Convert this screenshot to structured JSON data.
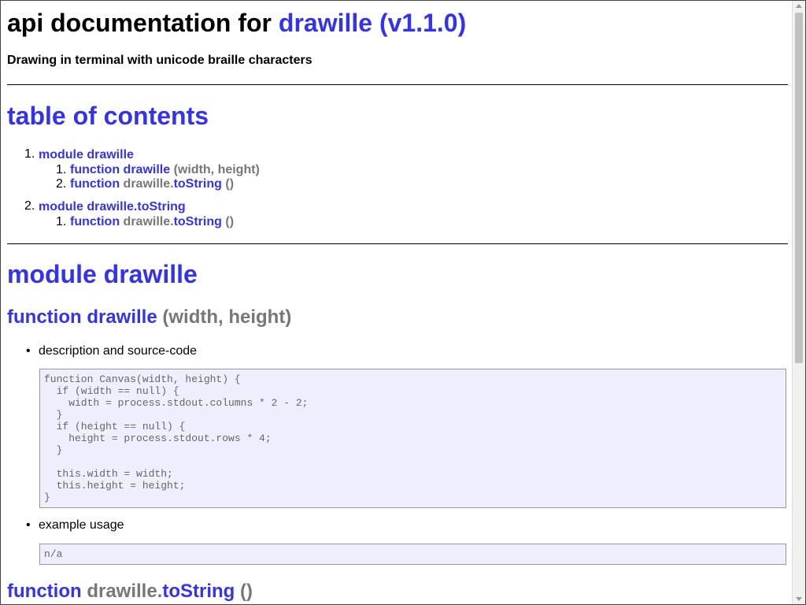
{
  "header": {
    "title_prefix": "api documentation for",
    "title_link": "drawille (v1.1.0)",
    "subtitle": "Drawing in terminal with unicode braille characters"
  },
  "toc": {
    "heading": "table of contents",
    "items": [
      {
        "num": "1.",
        "label": "module drawille",
        "subs": [
          {
            "num": "1.",
            "kw": "function",
            "name": "drawille",
            "args": "(width, height)"
          },
          {
            "num": "2.",
            "kw": "function",
            "owner": "drawille.",
            "name": "toString",
            "args": "()"
          }
        ]
      },
      {
        "num": "2.",
        "label": "module drawille.toString",
        "subs": [
          {
            "num": "1.",
            "kw": "function",
            "owner": "drawille.",
            "name": "toString",
            "args": "()"
          }
        ]
      }
    ]
  },
  "module": {
    "heading": "module drawille",
    "fn1": {
      "kw": "function",
      "name": "drawille",
      "args": "(width, height)",
      "desc_label": "description and source-code",
      "source": "function Canvas(width, height) {\n  if (width == null) {\n    width = process.stdout.columns * 2 - 2;\n  }\n  if (height == null) {\n    height = process.stdout.rows * 4;\n  }\n\n  this.width = width;\n  this.height = height;\n}",
      "example_label": "example usage",
      "example": "n/a"
    },
    "fn2": {
      "kw": "function",
      "owner": "drawille.",
      "name": "toString",
      "args": "()"
    }
  },
  "colors": {
    "link": "#3333ee",
    "muted": "#777777",
    "code_bg": "#eeeeff"
  }
}
